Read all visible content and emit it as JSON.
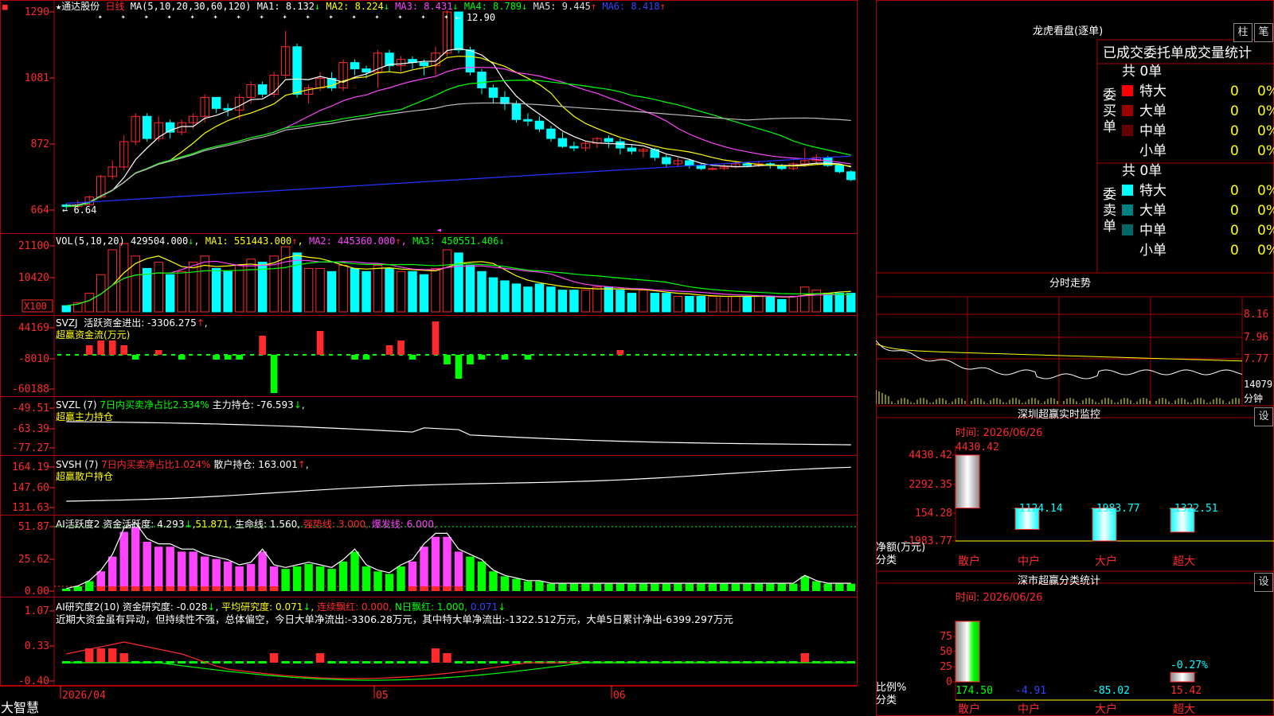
{
  "colors": {
    "up": "#ff2a2a",
    "down": "#00ffff",
    "grid": "#b00000",
    "ma1": "#ffffff",
    "ma2": "#ffff00",
    "ma3": "#ff44ff",
    "ma4": "#00ff00",
    "ma5": "#bbbbbb",
    "ma6": "#2233ff",
    "white": "#ffffff",
    "yellow": "#ffff00",
    "magenta": "#ff44ff",
    "green": "#00ff00",
    "red": "#ff2a2a",
    "cyan": "#00ffff"
  },
  "app": {
    "brand": "大智慧",
    "flag_icon": "flag-icon"
  },
  "main": {
    "star": "★",
    "stock_name": "通达股份",
    "period": "日线",
    "ma_params": "MA(5,10,20,30,60,120)",
    "ma_values": [
      {
        "label": "MA1:",
        "value": "8.132",
        "arrow": "↓"
      },
      {
        "label": "MA2:",
        "value": "8.224",
        "arrow": "↓"
      },
      {
        "label": "MA3:",
        "value": "8.431",
        "arrow": "↓"
      },
      {
        "label": "MA4:",
        "value": "8.789",
        "arrow": "↓"
      },
      {
        "label": "MA5:",
        "value": "9.445",
        "arrow": "↑"
      },
      {
        "label": "MA6:",
        "value": "8.418",
        "arrow": "↑"
      }
    ],
    "y_ticks": [
      "1290",
      "1081",
      "872",
      "664"
    ],
    "high_label": "12.90",
    "low_label": "6.64"
  },
  "vol": {
    "title": "VOL(5,10,20)",
    "value": "429504.000",
    "arrow": "↓",
    "ma": [
      {
        "label": "MA1:",
        "value": "551443.000",
        "arrow": "↑"
      },
      {
        "label": "MA2:",
        "value": "445360.000",
        "arrow": "↑"
      },
      {
        "label": "MA3:",
        "value": "450551.406",
        "arrow": "↓"
      }
    ],
    "y_ticks": [
      "21100",
      "10420"
    ],
    "unit": "X100"
  },
  "svzj": {
    "title": "SVZJ",
    "text1": "活跃资金进出:",
    "value": "-3306.275",
    "arrow": "↑",
    "comma": ",",
    "sub": "超赢资金流(万元)",
    "y_ticks": [
      "44169",
      "-8010",
      "-60188"
    ]
  },
  "svzl": {
    "title": "SVZL (7)",
    "text1": "7日内买卖净占比2.334%",
    "text2": "主力持仓:",
    "value": "-76.593",
    "arrow": "↓",
    "comma": ",",
    "sub": "超赢主力持仓",
    "y_ticks": [
      "-49.51",
      "-63.39",
      "-77.27"
    ]
  },
  "svsh": {
    "title": "SVSH (7)",
    "text1": "7日内买卖净占比1.024%",
    "text2": "散户持仓:",
    "value": "163.001",
    "arrow": "↑",
    "comma": ",",
    "sub": "超赢散户持仓",
    "y_ticks": [
      "164.19",
      "147.60",
      "131.63"
    ]
  },
  "ai1": {
    "title": "AI活跃度2",
    "t1": "资金活跃度:",
    "v1": "4.293",
    "a1": "↓",
    "v2": "51.871",
    "c2": ",",
    "t3": "生命线:",
    "v3": "1.560",
    "c3": ",",
    "t4": "强势线:",
    "v4": "3.000",
    "c4": ",",
    "t5": "爆发线:",
    "v5": "6.000",
    "c5": ",",
    "y_ticks": [
      "51.87",
      "25.62",
      "0.00"
    ]
  },
  "ai2": {
    "title": "AI研究度2(10)",
    "t1": "资金研究度:",
    "v1": "-0.028",
    "a1": "↓",
    "t2": "平均研究度:",
    "v2": "0.071",
    "a2": "↓",
    "t3": "连续飘红:",
    "v3": "0.000",
    "c3": ",",
    "t4": "N日飘红:",
    "v4": "1.000",
    "c4": ",",
    "v5": "0.071",
    "a5": "↓",
    "comment": "近期大资金虽有异动，但持续性不强，总体偏空，今日大单净流出:-3306.28万元，其中特大单净流出:-1322.512万元，大单5日累计净出-6399.297万元",
    "y_ticks": [
      "1.07",
      "0.33",
      "-0.40"
    ]
  },
  "xaxis": {
    "labels": [
      "2026/04",
      "05",
      "06"
    ]
  },
  "dragon": {
    "title": "龙虎看盘(逐单)",
    "btn_zhu": "柱",
    "btn_bi": "笔",
    "header": "已成交委托单成交量统计",
    "buy": {
      "side": [
        "委",
        "买",
        "单"
      ],
      "total": "共 0单",
      "rows": [
        {
          "name": "特大",
          "count": "0",
          "pct": "0%",
          "color": "#ff0000"
        },
        {
          "name": "大单",
          "count": "0",
          "pct": "0%",
          "color": "#9a0000"
        },
        {
          "name": "中单",
          "count": "0",
          "pct": "0%",
          "color": "#660000"
        },
        {
          "name": "小单",
          "count": "0",
          "pct": "0%",
          "color": "#000000"
        }
      ]
    },
    "sell": {
      "side": [
        "委",
        "卖",
        "单"
      ],
      "total": "共 0单",
      "rows": [
        {
          "name": "特大",
          "count": "0",
          "pct": "0%",
          "color": "#00ffff"
        },
        {
          "name": "大单",
          "count": "0",
          "pct": "0%",
          "color": "#008080"
        },
        {
          "name": "中单",
          "count": "0",
          "pct": "0%",
          "color": "#006666"
        },
        {
          "name": "小单",
          "count": "0",
          "pct": "0%",
          "color": "#000000"
        }
      ]
    }
  },
  "intraday": {
    "title": "分时走势",
    "y_ticks": [
      "8.16",
      "7.96",
      "7.77"
    ],
    "vol_tick": "14079",
    "vol_unit": "分钟"
  },
  "monitor": {
    "title": "深圳超赢实时监控",
    "set_btn": "设",
    "time_label": "时间: 2026/06/26",
    "y_ticks": [
      "4430.42",
      "2292.35",
      "154.28",
      "-1983.77"
    ],
    "y_unit": "净额(万元)",
    "x_unit": "分类",
    "chart_data": {
      "type": "bar",
      "categories": [
        "散户",
        "中户",
        "大户",
        "超大"
      ],
      "values": [
        4430.42,
        -1124.14,
        -1983.77,
        -1322.51
      ],
      "labels": [
        "4430.42",
        "-1124.14",
        "-1983.77",
        "-1322.51"
      ],
      "ylim": [
        -1983.77,
        4430.42
      ]
    }
  },
  "classify": {
    "title": "深市超赢分类统计",
    "set_btn": "设",
    "time_label": "时间: 2026/06/26",
    "y_ticks": [
      "75",
      "50",
      "25",
      "0"
    ],
    "y_unit": "比例%",
    "x_unit": "分类",
    "chart_data": {
      "type": "bar",
      "categories": [
        "散户",
        "中户",
        "大户",
        "超大"
      ],
      "values": [
        174.5,
        -4.91,
        -85.02,
        15.42
      ],
      "labels": [
        "174.50",
        "-4.91",
        "-85.02",
        "15.42"
      ],
      "annotation": "-0.27%",
      "ylim": [
        0,
        75
      ]
    }
  }
}
